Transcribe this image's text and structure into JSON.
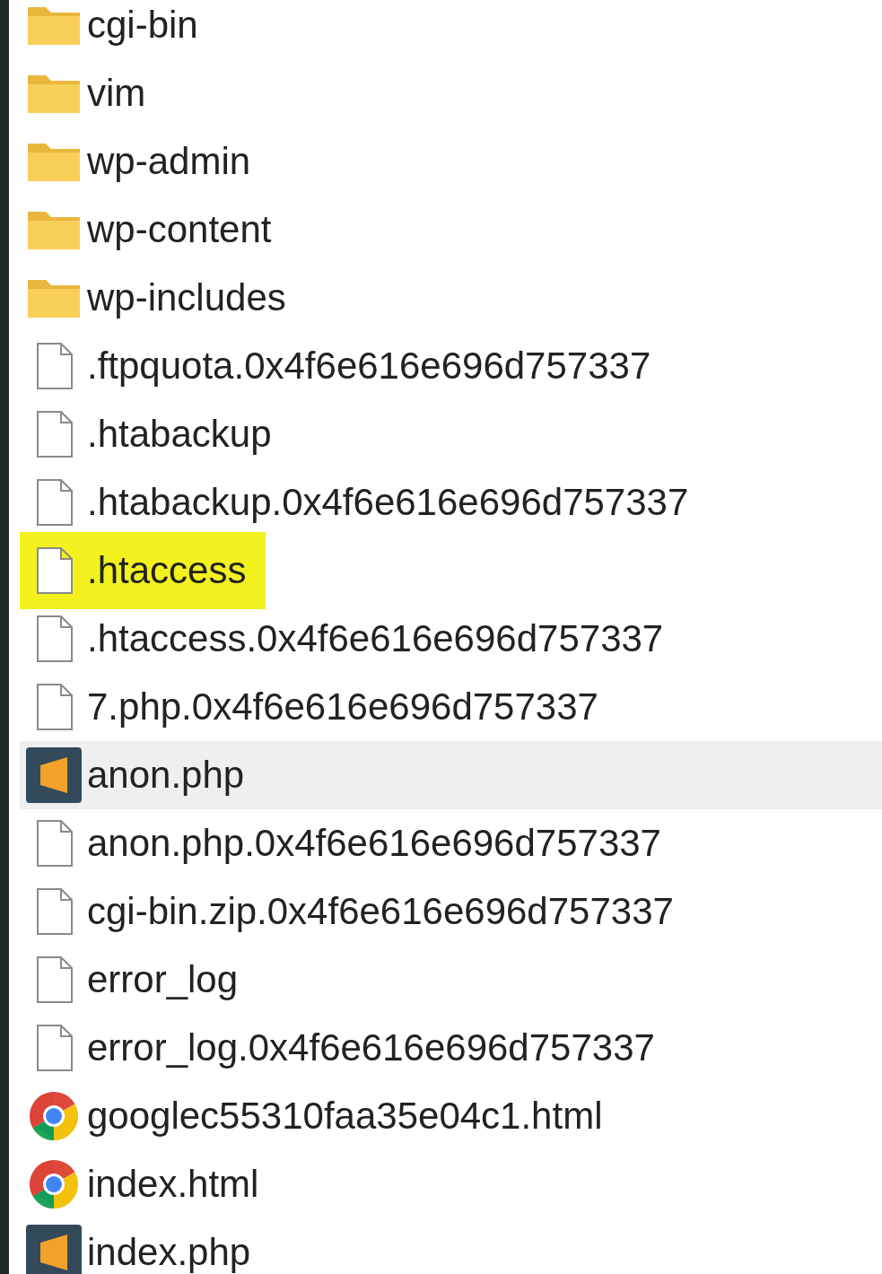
{
  "files": [
    {
      "name": "cgi-bin",
      "kind": "folder",
      "selected": false,
      "highlighted": false
    },
    {
      "name": "vim",
      "kind": "folder",
      "selected": false,
      "highlighted": false
    },
    {
      "name": "wp-admin",
      "kind": "folder",
      "selected": false,
      "highlighted": false
    },
    {
      "name": "wp-content",
      "kind": "folder",
      "selected": false,
      "highlighted": false
    },
    {
      "name": "wp-includes",
      "kind": "folder",
      "selected": false,
      "highlighted": false
    },
    {
      "name": ".ftpquota.0x4f6e616e696d757337",
      "kind": "file",
      "selected": false,
      "highlighted": false
    },
    {
      "name": ".htabackup",
      "kind": "file",
      "selected": false,
      "highlighted": false
    },
    {
      "name": ".htabackup.0x4f6e616e696d757337",
      "kind": "file",
      "selected": false,
      "highlighted": false
    },
    {
      "name": ".htaccess",
      "kind": "file",
      "selected": false,
      "highlighted": true
    },
    {
      "name": ".htaccess.0x4f6e616e696d757337",
      "kind": "file",
      "selected": false,
      "highlighted": false
    },
    {
      "name": "7.php.0x4f6e616e696d757337",
      "kind": "file",
      "selected": false,
      "highlighted": false
    },
    {
      "name": "anon.php",
      "kind": "sublime",
      "selected": true,
      "highlighted": false
    },
    {
      "name": "anon.php.0x4f6e616e696d757337",
      "kind": "file",
      "selected": false,
      "highlighted": false
    },
    {
      "name": "cgi-bin.zip.0x4f6e616e696d757337",
      "kind": "file",
      "selected": false,
      "highlighted": false
    },
    {
      "name": "error_log",
      "kind": "file",
      "selected": false,
      "highlighted": false
    },
    {
      "name": "error_log.0x4f6e616e696d757337",
      "kind": "file",
      "selected": false,
      "highlighted": false
    },
    {
      "name": "googlec55310faa35e04c1.html",
      "kind": "chrome",
      "selected": false,
      "highlighted": false
    },
    {
      "name": "index.html",
      "kind": "chrome",
      "selected": false,
      "highlighted": false
    },
    {
      "name": "index.php",
      "kind": "sublime",
      "selected": false,
      "highlighted": false
    }
  ]
}
